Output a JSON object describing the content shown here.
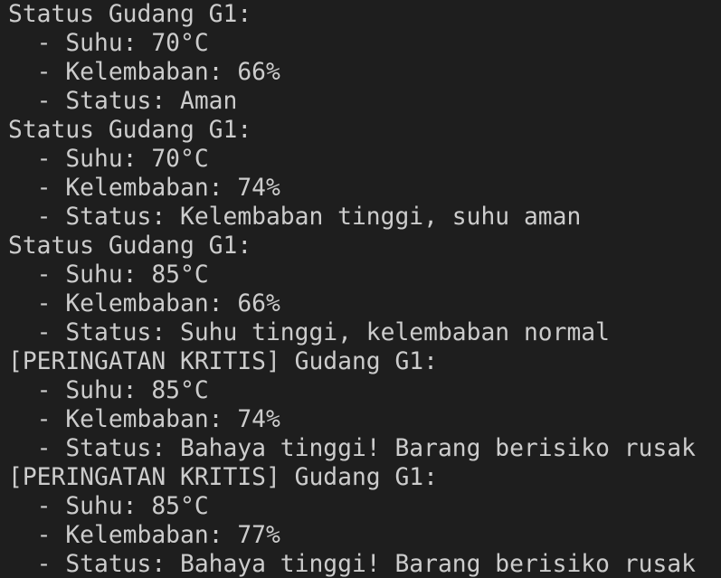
{
  "terminal": {
    "lines": [
      "Status Gudang G1:",
      "  - Suhu: 70°C",
      "  - Kelembaban: 66%",
      "  - Status: Aman",
      "Status Gudang G1:",
      "  - Suhu: 70°C",
      "  - Kelembaban: 74%",
      "  - Status: Kelembaban tinggi, suhu aman",
      "Status Gudang G1:",
      "  - Suhu: 85°C",
      "  - Kelembaban: 66%",
      "  - Status: Suhu tinggi, kelembaban normal",
      "[PERINGATAN KRITIS] Gudang G1:",
      "  - Suhu: 85°C",
      "  - Kelembaban: 74%",
      "  - Status: Bahaya tinggi! Barang berisiko rusak",
      "[PERINGATAN KRITIS] Gudang G1:",
      "  - Suhu: 85°C",
      "  - Kelembaban: 77%",
      "  - Status: Bahaya tinggi! Barang berisiko rusak"
    ]
  },
  "colors": {
    "background": "#1e1e1e",
    "text": "#cccccc"
  }
}
